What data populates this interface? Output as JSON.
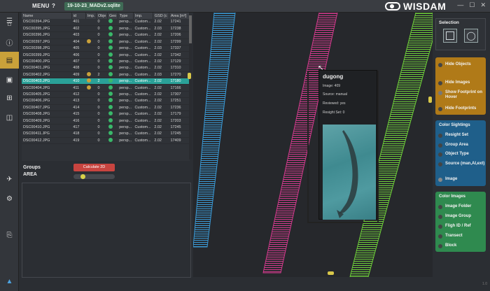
{
  "topbar": {
    "menu_label": "MENU",
    "help_label": "?",
    "file_tab": "19-10-23_MADv2.sqlite",
    "app_name": "WISDAM",
    "minimize": "—",
    "maximize": "☐",
    "close": "✕"
  },
  "rail_icons": [
    "home-icon",
    "info-icon",
    "map-icon",
    "image-icon",
    "grid-icon",
    "save-icon",
    "flight-icon",
    "settings-icon",
    "report-icon"
  ],
  "table": {
    "columns": [
      "Name",
      "id",
      "Imp.",
      "Obje",
      "Geo",
      "Type",
      "Imp.",
      "GSD (c",
      "Area [m²]"
    ],
    "rows": [
      {
        "name": "DSC00394.JPG",
        "id": "401",
        "imp": "",
        "obj": "0",
        "type": "persp...",
        "cam": "Custom...",
        "gsd": "2.02",
        "area": "17241",
        "geo": true,
        "flag": false
      },
      {
        "name": "DSC00395.JPG",
        "id": "402",
        "imp": "",
        "obj": "0",
        "type": "persp...",
        "cam": "Custom...",
        "gsd": "2.03",
        "area": "17238",
        "geo": true,
        "flag": false
      },
      {
        "name": "DSC00396.JPG",
        "id": "403",
        "imp": "",
        "obj": "0",
        "type": "persp...",
        "cam": "Custom...",
        "gsd": "2.02",
        "area": "17206",
        "geo": true,
        "flag": false
      },
      {
        "name": "DSC00397.JPG",
        "id": "404",
        "imp": "",
        "obj": "0",
        "type": "persp...",
        "cam": "Custom...",
        "gsd": "2.02",
        "area": "17299",
        "geo": true,
        "flag": true
      },
      {
        "name": "DSC00398.JPG",
        "id": "405",
        "imp": "",
        "obj": "0",
        "type": "persp...",
        "cam": "Custom...",
        "gsd": "2.03",
        "area": "17337",
        "geo": true,
        "flag": false
      },
      {
        "name": "DSC00399.JPG",
        "id": "406",
        "imp": "",
        "obj": "0",
        "type": "persp...",
        "cam": "Custom...",
        "gsd": "2.02",
        "area": "17342",
        "geo": true,
        "flag": false
      },
      {
        "name": "DSC00400.JPG",
        "id": "407",
        "imp": "",
        "obj": "0",
        "type": "persp...",
        "cam": "Custom...",
        "gsd": "2.02",
        "area": "17129",
        "geo": true,
        "flag": false
      },
      {
        "name": "DSC00401.JPG",
        "id": "408",
        "imp": "",
        "obj": "0",
        "type": "persp...",
        "cam": "Custom...",
        "gsd": "2.02",
        "area": "17310",
        "geo": true,
        "flag": false
      },
      {
        "name": "DSC00402.JPG",
        "id": "409",
        "imp": "",
        "obj": "2",
        "type": "persp...",
        "cam": "Custom...",
        "gsd": "2.03",
        "area": "17270",
        "geo": true,
        "flag": true
      },
      {
        "name": "DSC00403.JPG",
        "id": "410",
        "imp": "",
        "obj": "2",
        "type": "persp...",
        "cam": "Custom...",
        "gsd": "2.02",
        "area": "17180",
        "geo": true,
        "flag": true,
        "selected": true
      },
      {
        "name": "DSC00404.JPG",
        "id": "411",
        "imp": "",
        "obj": "0",
        "type": "persp...",
        "cam": "Custom...",
        "gsd": "2.02",
        "area": "17166",
        "geo": true,
        "flag": true
      },
      {
        "name": "DSC00405.JPG",
        "id": "412",
        "imp": "",
        "obj": "0",
        "type": "persp...",
        "cam": "Custom...",
        "gsd": "2.02",
        "area": "17307",
        "geo": true,
        "flag": false
      },
      {
        "name": "DSC00406.JPG",
        "id": "413",
        "imp": "",
        "obj": "0",
        "type": "persp...",
        "cam": "Custom...",
        "gsd": "2.02",
        "area": "17251",
        "geo": true,
        "flag": false
      },
      {
        "name": "DSC00407.JPG",
        "id": "414",
        "imp": "",
        "obj": "0",
        "type": "persp...",
        "cam": "Custom...",
        "gsd": "2.02",
        "area": "17236",
        "geo": true,
        "flag": false
      },
      {
        "name": "DSC00408.JPG",
        "id": "415",
        "imp": "",
        "obj": "0",
        "type": "persp...",
        "cam": "Custom...",
        "gsd": "2.02",
        "area": "17179",
        "geo": true,
        "flag": false
      },
      {
        "name": "DSC00409.JPG",
        "id": "416",
        "imp": "",
        "obj": "0",
        "type": "persp...",
        "cam": "Custom...",
        "gsd": "2.02",
        "area": "17203",
        "geo": true,
        "flag": false
      },
      {
        "name": "DSC00410.JPG",
        "id": "417",
        "imp": "",
        "obj": "0",
        "type": "persp...",
        "cam": "Custom...",
        "gsd": "2.02",
        "area": "17245",
        "geo": true,
        "flag": false
      },
      {
        "name": "DSC00411.JPG",
        "id": "418",
        "imp": "",
        "obj": "0",
        "type": "persp...",
        "cam": "Custom...",
        "gsd": "2.02",
        "area": "17245",
        "geo": true,
        "flag": false
      },
      {
        "name": "DSC00412.JPG",
        "id": "419",
        "imp": "",
        "obj": "0",
        "type": "persp...",
        "cam": "Custom...",
        "gsd": "2.02",
        "area": "17409",
        "geo": true,
        "flag": false
      }
    ]
  },
  "groups": {
    "groups_label": "Groups",
    "area_label": "AREA",
    "calculate_label": "Calculate 2D",
    "slider_value": 0.2
  },
  "popup": {
    "title": "dugong",
    "image": "Image: 409",
    "source": "Source: manual",
    "reviewed": "Reviewed: yes",
    "resight": "Resight Set: 0"
  },
  "selection": {
    "title": "Selection",
    "rect_icon": "rectangle-select-icon",
    "lasso_icon": "lasso-select-icon"
  },
  "visibility": {
    "hide_objects": "Hide Objects",
    "hide_images": "Hide Images",
    "show_footprint": "Show Footprint on Hover",
    "hide_footprints": "Hide Footprints"
  },
  "color_sightings": {
    "title": "Color Sightings",
    "resight_set": "Resight Set",
    "group_area": "Group Area",
    "object_type": "Object Type",
    "source": "Source (man,AI,ext)",
    "image": "Image"
  },
  "color_images": {
    "title": "Color Images",
    "image_folder": "Image Folder",
    "image_group": "Image Group",
    "flight_id": "Fligh ID / Ref",
    "transect": "Transect",
    "block": "Block"
  },
  "colors": {
    "accent_gold": "#c9a13a",
    "selected_row": "#2aa198",
    "strip_blue": "#3a9ad6",
    "strip_pink": "#d13a8c",
    "strip_green": "#6fcf3a",
    "panel_orange": "#b07a18",
    "panel_blue": "#1f5f8a",
    "panel_green": "#2f8a4f",
    "calc_red": "#c8443f"
  },
  "status": {
    "version": "1.0"
  }
}
